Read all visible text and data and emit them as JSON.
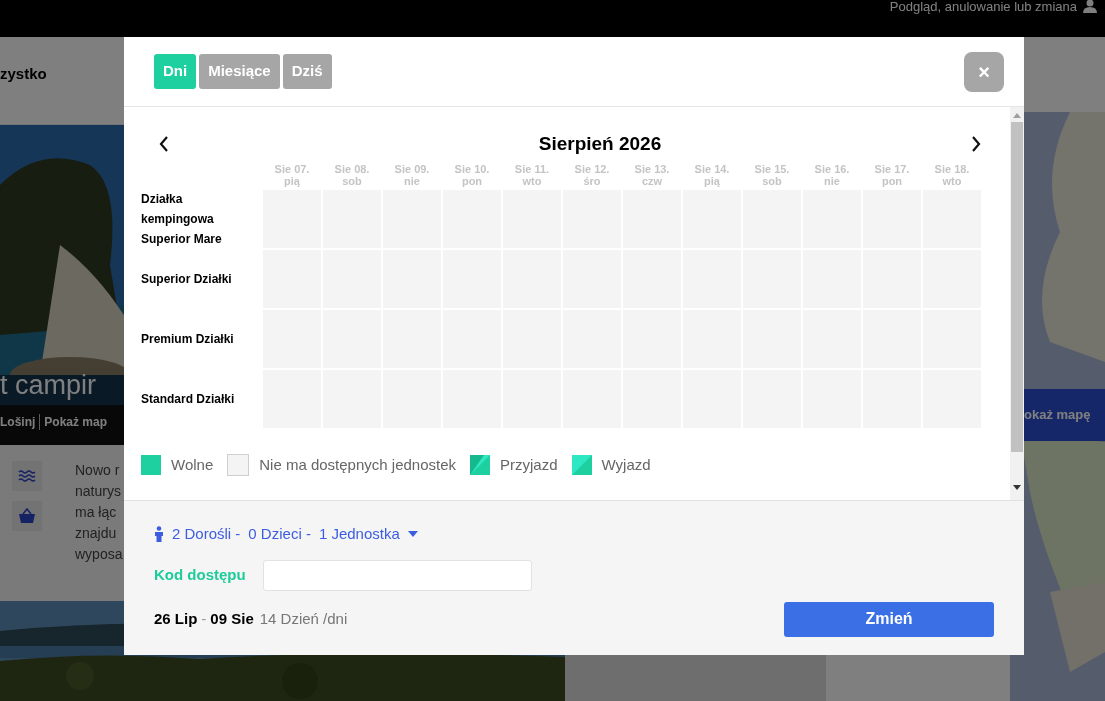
{
  "top_bar": {
    "link": "Podgląd, anulowanie lub zmiana"
  },
  "background": {
    "nav_text": "zystko",
    "hero_title": "t campir",
    "hero_location": "Lošinj",
    "hero_map_link": "Pokaż map",
    "description_lines": [
      "Nowo r",
      "naturys",
      "ma łąc",
      "znajdu",
      "wyposa"
    ],
    "map_button": "okaż mapę"
  },
  "dialog": {
    "view_tabs": [
      {
        "label": "Dni",
        "selected": true
      },
      {
        "label": "Miesiące",
        "selected": false
      },
      {
        "label": "Dziś",
        "selected": false
      }
    ],
    "close": "×",
    "month": "Sierpień 2026",
    "days": [
      {
        "date": "Sie 07.",
        "weekday": "pią"
      },
      {
        "date": "Sie 08.",
        "weekday": "sob"
      },
      {
        "date": "Sie 09.",
        "weekday": "nie"
      },
      {
        "date": "Sie 10.",
        "weekday": "pon"
      },
      {
        "date": "Sie 11.",
        "weekday": "wto"
      },
      {
        "date": "Sie 12.",
        "weekday": "śro"
      },
      {
        "date": "Sie 13.",
        "weekday": "czw"
      },
      {
        "date": "Sie 14.",
        "weekday": "pią"
      },
      {
        "date": "Sie 15.",
        "weekday": "sob"
      },
      {
        "date": "Sie 16.",
        "weekday": "nie"
      },
      {
        "date": "Sie 17.",
        "weekday": "pon"
      },
      {
        "date": "Sie 18.",
        "weekday": "wto"
      }
    ],
    "units": [
      {
        "name": "Działka kempingowa Superior Mare"
      },
      {
        "name": "Superior Działki"
      },
      {
        "name": "Premium Działki"
      },
      {
        "name": "Standard Działki"
      }
    ],
    "legend": [
      {
        "kind": "free",
        "label": "Wolne"
      },
      {
        "kind": "unavailable",
        "label": "Nie ma dostępnych jednostek"
      },
      {
        "kind": "arrival",
        "label": "Przyjazd"
      },
      {
        "kind": "departure",
        "label": "Wyjazd"
      }
    ],
    "guests": [
      "2 Dorośli -",
      "0 Dzieci -",
      "1 Jednostka"
    ],
    "access_code_label": "Kod dostępu",
    "date_from": "26 Lip",
    "date_separator": "-",
    "date_to": "09 Sie",
    "duration": "14 Dzień /dni",
    "submit": "Zmień"
  }
}
